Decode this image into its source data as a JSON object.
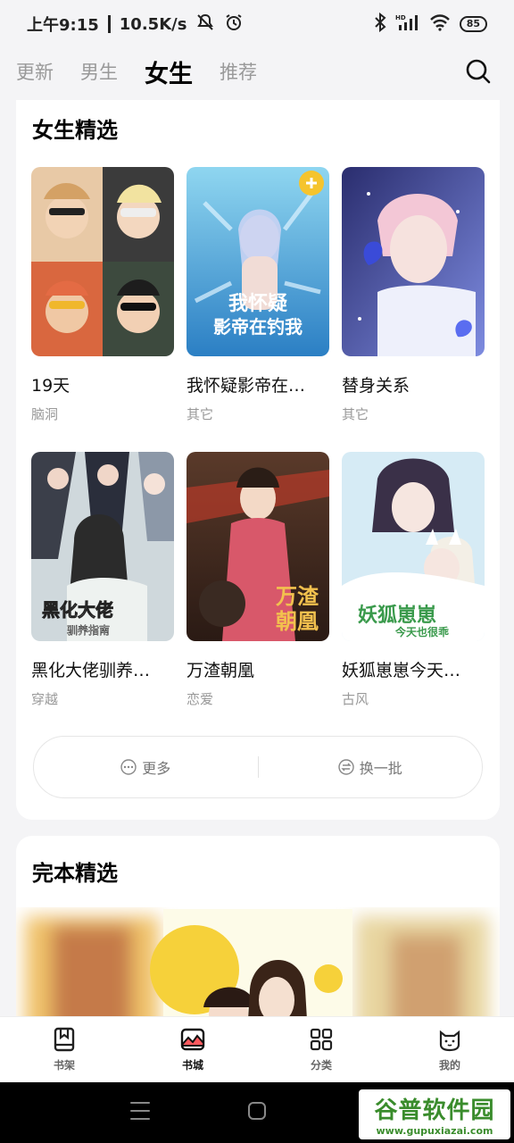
{
  "status": {
    "time": "上午9:15",
    "speed": "10.5K/s",
    "battery": "85",
    "hd": "HD"
  },
  "tabs": [
    "更新",
    "男生",
    "女生",
    "推荐"
  ],
  "female_section": {
    "title": "女生精选",
    "books": [
      {
        "title": "19天",
        "genre": "脑洞"
      },
      {
        "title": "我怀疑影帝在…",
        "genre": "其它"
      },
      {
        "title": "替身关系",
        "genre": "其它"
      },
      {
        "title": "黑化大佬驯养…",
        "genre": "穿越"
      },
      {
        "title": "万渣朝凰",
        "genre": "恋爱"
      },
      {
        "title": "妖狐崽崽今天…",
        "genre": "古风"
      }
    ],
    "more_label": "更多",
    "refresh_label": "换一批"
  },
  "complete_section": {
    "title": "完本精选"
  },
  "bottom_nav": [
    "书架",
    "书城",
    "分类",
    "我的"
  ],
  "watermark": {
    "main": "谷普软件园",
    "sub": "www.gupuxiazai.com"
  }
}
